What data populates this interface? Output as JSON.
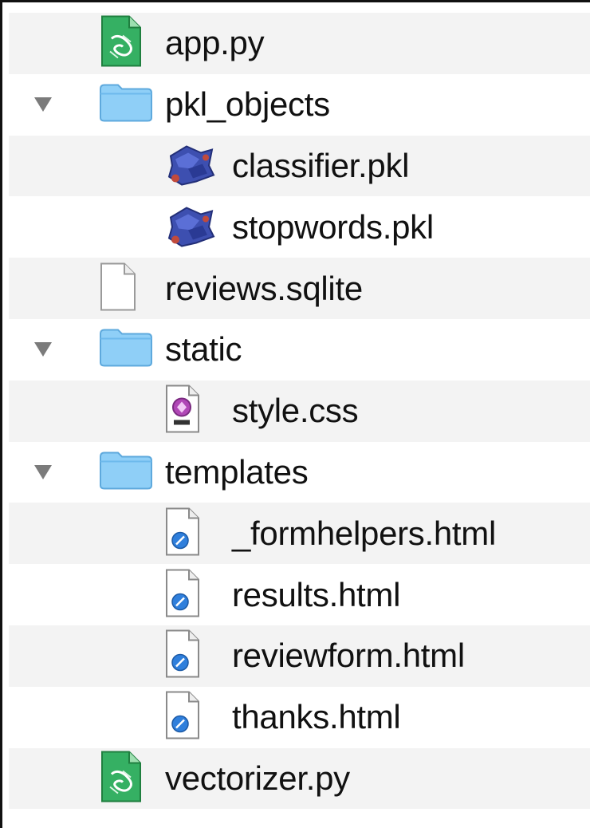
{
  "file_tree": {
    "items": [
      {
        "label": "app.py",
        "icon": "python-file-icon",
        "level": 0,
        "stripe": true
      },
      {
        "label": "pkl_objects",
        "icon": "folder-icon",
        "level": 0,
        "expanded": true,
        "stripe": false
      },
      {
        "label": "classifier.pkl",
        "icon": "pickle-file-icon",
        "level": 1,
        "stripe": true
      },
      {
        "label": "stopwords.pkl",
        "icon": "pickle-file-icon",
        "level": 1,
        "stripe": false
      },
      {
        "label": "reviews.sqlite",
        "icon": "blank-document-icon",
        "level": 0,
        "stripe": true
      },
      {
        "label": "static",
        "icon": "folder-icon",
        "level": 0,
        "expanded": true,
        "stripe": false
      },
      {
        "label": "style.css",
        "icon": "css-file-icon",
        "level": 1,
        "stripe": true
      },
      {
        "label": "templates",
        "icon": "folder-icon",
        "level": 0,
        "expanded": true,
        "stripe": false
      },
      {
        "label": "_formhelpers.html",
        "icon": "html-file-icon",
        "level": 1,
        "stripe": true
      },
      {
        "label": "results.html",
        "icon": "html-file-icon",
        "level": 1,
        "stripe": false
      },
      {
        "label": "reviewform.html",
        "icon": "html-file-icon",
        "level": 1,
        "stripe": true
      },
      {
        "label": "thanks.html",
        "icon": "html-file-icon",
        "level": 1,
        "stripe": false
      },
      {
        "label": "vectorizer.py",
        "icon": "python-file-icon",
        "level": 0,
        "stripe": true
      }
    ]
  },
  "colors": {
    "stripe": "#f3f3f3",
    "folder": "#8fcff7",
    "python_icon": "#2fa45a",
    "html_icon": "#2f7fdc",
    "css_icon": "#b047b6"
  }
}
